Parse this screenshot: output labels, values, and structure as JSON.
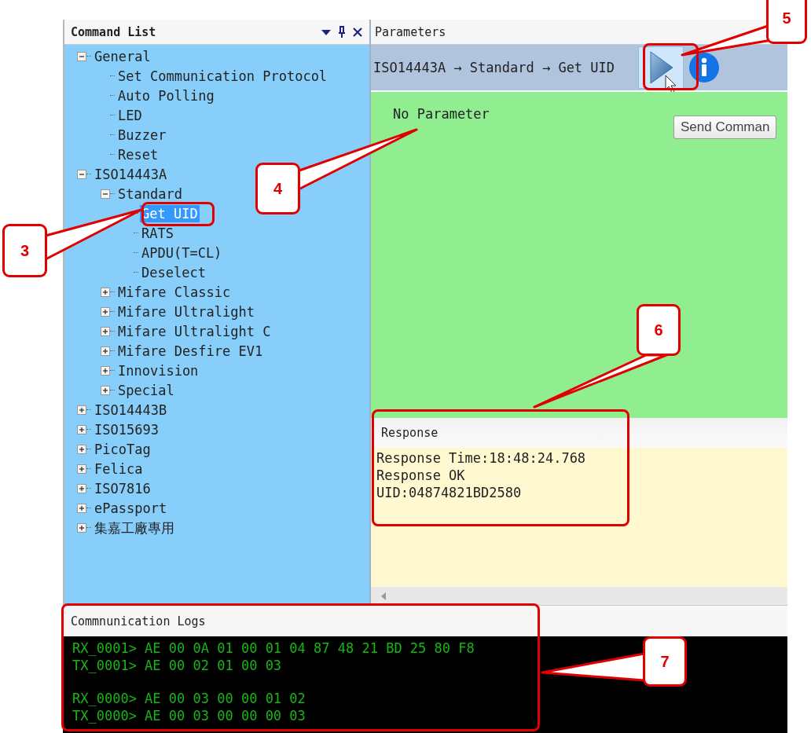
{
  "command_list": {
    "title": "Command List",
    "tree": [
      {
        "label": "General",
        "expanded": true,
        "selected": false,
        "children": [
          {
            "label": "Set Communication Protocol",
            "selected": false
          },
          {
            "label": "Auto Polling",
            "selected": false
          },
          {
            "label": "LED",
            "selected": false
          },
          {
            "label": "Buzzer",
            "selected": false
          },
          {
            "label": "Reset",
            "selected": false
          }
        ]
      },
      {
        "label": "ISO14443A",
        "expanded": true,
        "selected": false,
        "children": [
          {
            "label": "Standard",
            "expanded": true,
            "selected": false,
            "children": [
              {
                "label": "Get UID",
                "selected": true
              },
              {
                "label": "RATS",
                "selected": false
              },
              {
                "label": "APDU(T=CL)",
                "selected": false
              },
              {
                "label": "Deselect",
                "selected": false
              }
            ]
          },
          {
            "label": "Mifare Classic",
            "expanded": false,
            "selected": false
          },
          {
            "label": "Mifare Ultralight",
            "expanded": false,
            "selected": false
          },
          {
            "label": "Mifare Ultralight C",
            "expanded": false,
            "selected": false
          },
          {
            "label": "Mifare Desfire EV1",
            "expanded": false,
            "selected": false
          },
          {
            "label": "Innovision",
            "expanded": false,
            "selected": false
          },
          {
            "label": "Special",
            "expanded": false,
            "selected": false
          }
        ]
      },
      {
        "label": "ISO14443B",
        "expanded": false,
        "selected": false
      },
      {
        "label": "ISO15693",
        "expanded": false,
        "selected": false
      },
      {
        "label": "PicoTag",
        "expanded": false,
        "selected": false
      },
      {
        "label": "Felica",
        "expanded": false,
        "selected": false
      },
      {
        "label": "ISO7816",
        "expanded": false,
        "selected": false
      },
      {
        "label": "ePassport",
        "expanded": false,
        "selected": false
      },
      {
        "label": "集嘉工廠專用",
        "expanded": false,
        "selected": false
      }
    ]
  },
  "parameters": {
    "title": "Parameters",
    "breadcrumb": "ISO14443A → Standard → Get UID",
    "message": "No Parameter",
    "tooltip": "Send Comman"
  },
  "response": {
    "title": "Response",
    "lines": [
      "Response Time:18:48:24.768",
      "Response OK",
      "UID:04874821BD2580"
    ]
  },
  "logs": {
    "title": "Commnunication Logs",
    "groups": [
      {
        "lines": [
          "RX_0001> AE 00 0A 01 00 01 04 87 48 21 BD 25 80 F8",
          "TX_0001> AE 00 02 01 00 03"
        ]
      },
      {
        "lines": [
          "RX_0000> AE 00 03 00 00 01 02",
          "TX_0000> AE 00 03 00 00 00 03"
        ]
      }
    ]
  },
  "callouts": [
    {
      "number": "3"
    },
    {
      "number": "4"
    },
    {
      "number": "5"
    },
    {
      "number": "6"
    },
    {
      "number": "7"
    }
  ]
}
